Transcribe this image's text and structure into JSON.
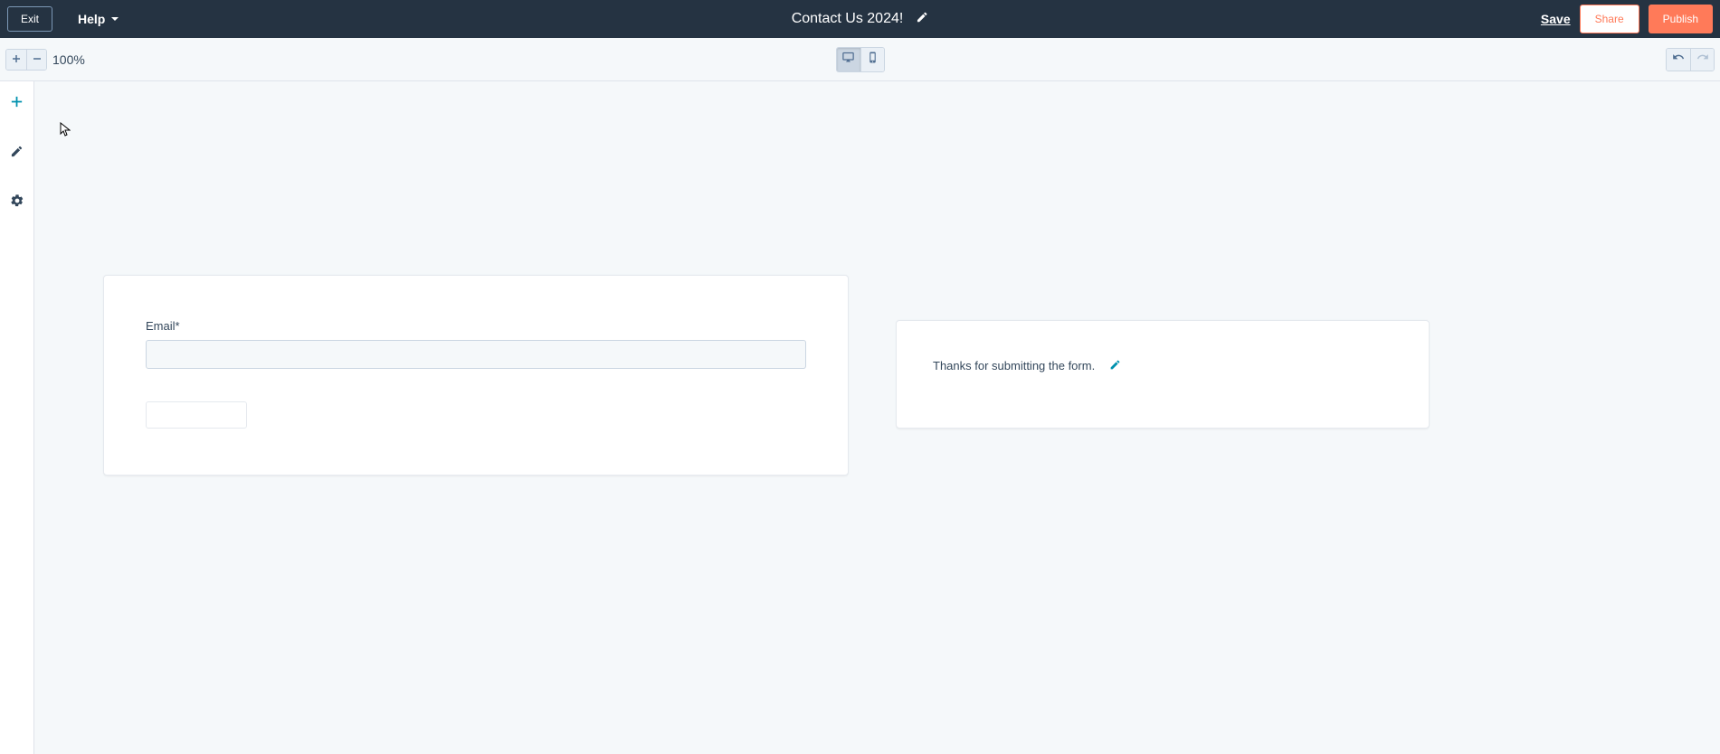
{
  "navbar": {
    "exit_label": "Exit",
    "help_label": "Help",
    "page_title": "Contact Us 2024!",
    "save_label": "Save",
    "share_label": "Share",
    "publish_label": "Publish"
  },
  "toolbar": {
    "zoom_level": "100%"
  },
  "form": {
    "email_label": "Email*"
  },
  "thankyou": {
    "message": "Thanks for submitting the form."
  },
  "icons": {
    "chevron_down": "chevron-down-icon",
    "pencil": "pencil-icon",
    "plus": "plus-icon",
    "minus": "minus-icon",
    "desktop": "desktop-icon",
    "mobile": "mobile-icon",
    "undo": "undo-icon",
    "redo": "redo-icon",
    "add_tool": "add-icon",
    "edit_tool": "edit-icon",
    "settings_tool": "gear-icon"
  },
  "colors": {
    "navbar_bg": "#253342",
    "accent": "#ff7a59",
    "link": "#0091ae"
  }
}
